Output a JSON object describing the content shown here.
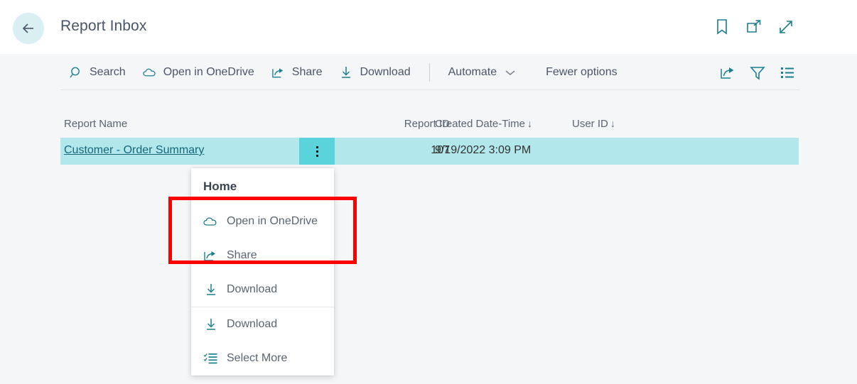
{
  "header": {
    "title": "Report Inbox",
    "back_icon": "arrow-left-icon",
    "actions": [
      {
        "name": "bookmark-icon",
        "label": "Bookmark"
      },
      {
        "name": "open-in-new-window-icon",
        "label": "Open in new window"
      },
      {
        "name": "expand-icon",
        "label": "Expand"
      }
    ]
  },
  "commandbar": {
    "items": [
      {
        "label": "Search",
        "icon": "search-icon"
      },
      {
        "label": "Open in OneDrive",
        "icon": "cloud-icon"
      },
      {
        "label": "Share",
        "icon": "share-icon"
      },
      {
        "label": "Download",
        "icon": "download-icon"
      },
      {
        "label": "Automate",
        "icon": "chevron-down-icon"
      },
      {
        "label": "Fewer options",
        "icon": ""
      }
    ],
    "right_icons": [
      {
        "name": "share-icon",
        "label": "Share"
      },
      {
        "name": "filter-icon",
        "label": "Filter"
      },
      {
        "name": "list-view-icon",
        "label": "List view"
      }
    ]
  },
  "grid": {
    "columns": [
      {
        "label": "Report Name",
        "sort": ""
      },
      {
        "label": "Report ID",
        "sort": ""
      },
      {
        "label": "Created Date-Time",
        "sort": "↓"
      },
      {
        "label": "User ID",
        "sort": "↓"
      }
    ],
    "rows": [
      {
        "report_name": "Customer - Order Summary",
        "report_id": "107",
        "created_datetime": "9/19/2022 3:09 PM",
        "user_id": ""
      }
    ]
  },
  "context_menu": {
    "header": "Home",
    "items": [
      {
        "label": "Open in OneDrive",
        "icon": "cloud-icon"
      },
      {
        "label": "Share",
        "icon": "share-icon"
      },
      {
        "label": "Download",
        "icon": "download-icon"
      },
      {
        "label": "Download",
        "icon": "download-icon"
      },
      {
        "label": "Select More",
        "icon": "select-more-icon"
      }
    ]
  },
  "annotation": {
    "color": "#fd0000",
    "shape": "rectangle"
  },
  "colors": {
    "accent_teal": "#1a7f8e",
    "row_selected": "#b2e8ec",
    "row_button": "#5bd3db",
    "page_background": "#f5f6f7",
    "link": "#14667a"
  }
}
